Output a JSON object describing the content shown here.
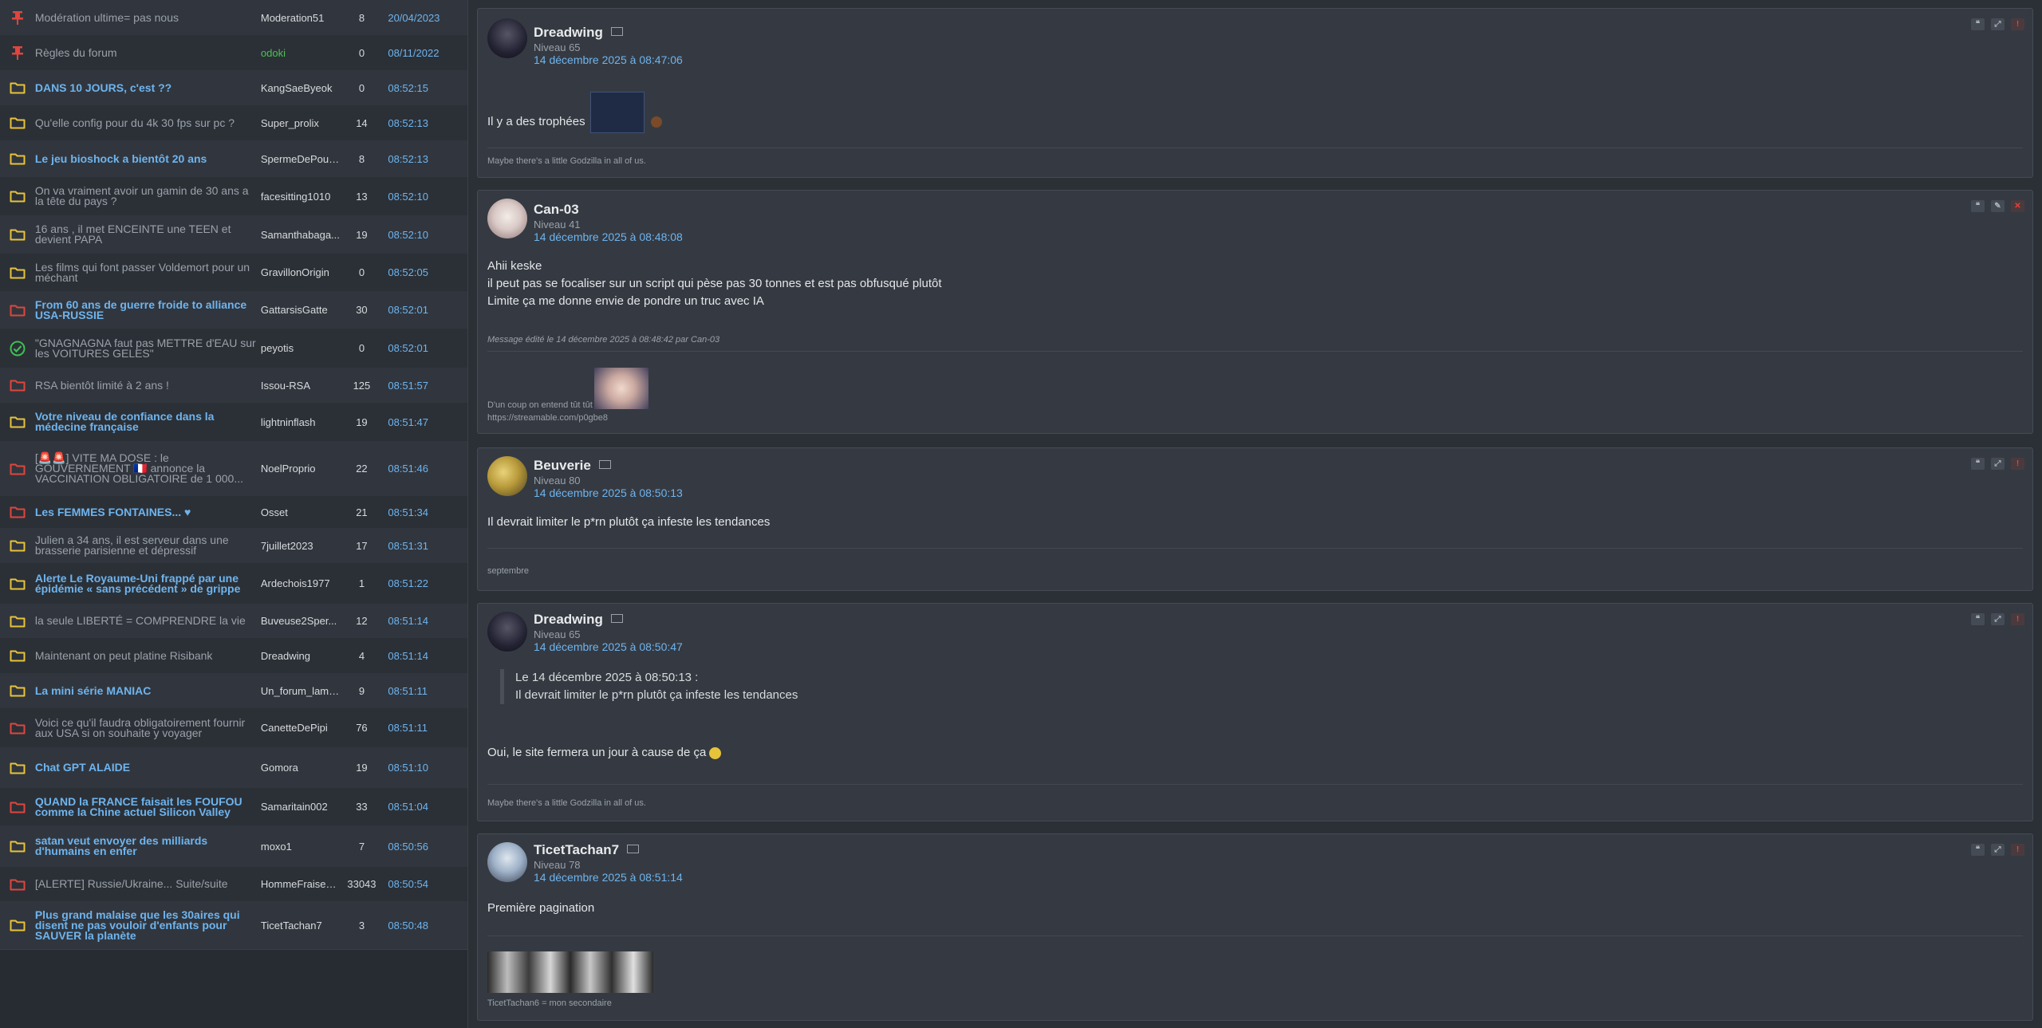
{
  "topics": [
    {
      "icon": "pin",
      "title": "Modération ultime= pas nous",
      "author": "Moderation51",
      "count": "8",
      "date": "20/04/2023",
      "style": "read"
    },
    {
      "icon": "pin",
      "title": "Règles du forum",
      "author": "odoki",
      "count": "0",
      "date": "08/11/2022",
      "style": "read",
      "admin": true
    },
    {
      "icon": "folder-yellow",
      "title": "DANS 10 JOURS, c'est ??",
      "author": "KangSaeByeok",
      "count": "0",
      "date": "08:52:15",
      "style": "hot"
    },
    {
      "icon": "folder-yellow",
      "title": "Qu'elle config pour du 4k 30 fps sur pc ?",
      "author": "Super_prolix",
      "count": "14",
      "date": "08:52:13",
      "style": "read"
    },
    {
      "icon": "folder-yellow",
      "title": "Le jeu bioshock a bientôt 20 ans",
      "author": "SpermeDePouti...",
      "count": "8",
      "date": "08:52:13",
      "style": "hot"
    },
    {
      "icon": "folder-yellow",
      "title": "On va vraiment avoir un gamin de 30 ans a la tête du pays ?",
      "author": "facesitting1010",
      "count": "13",
      "date": "08:52:10",
      "style": "read"
    },
    {
      "icon": "folder-yellow",
      "title": "16 ans , il met ENCEINTE une TEEN et devient PAPA",
      "author": "Samanthabaga...",
      "count": "19",
      "date": "08:52:10",
      "style": "read"
    },
    {
      "icon": "folder-yellow",
      "title": "Les films qui font passer Voldemort pour un méchant",
      "author": "GravillonOrigin",
      "count": "0",
      "date": "08:52:05",
      "style": "read"
    },
    {
      "icon": "folder-red",
      "title": "From 60 ans de guerre froide to alliance USA-RUSSIE",
      "author": "GattarsisGatte",
      "count": "30",
      "date": "08:52:01",
      "style": "hot"
    },
    {
      "icon": "resolved",
      "title": "\"GNAGNAGNA faut pas METTRE d'EAU sur les VOITURES GELES\"",
      "author": "peyotis",
      "count": "0",
      "date": "08:52:01",
      "style": "read"
    },
    {
      "icon": "folder-red",
      "title": "RSA bientôt limité à 2 ans !",
      "author": "Issou-RSA",
      "count": "125",
      "date": "08:51:57",
      "style": "read"
    },
    {
      "icon": "folder-yellow",
      "title": "Votre niveau de confiance dans la médecine française",
      "author": "lightninflash",
      "count": "19",
      "date": "08:51:47",
      "style": "hot"
    },
    {
      "icon": "folder-red",
      "title": "[🚨🚨] VITE MA DOSE : le GOUVERNEMENT 🇫🇷 annonce la VACCINATION OBLIGATOIRE de 1 000...",
      "author": "NoelProprio",
      "count": "22",
      "date": "08:51:46",
      "style": "read"
    },
    {
      "icon": "folder-red",
      "title": "Les FEMMES FONTAINES... ♥",
      "author": "Osset",
      "count": "21",
      "date": "08:51:34",
      "style": "hot"
    },
    {
      "icon": "folder-yellow",
      "title": "Julien a 34 ans, il est serveur dans une brasserie parisienne et dépressif",
      "author": "7juillet2023",
      "count": "17",
      "date": "08:51:31",
      "style": "read"
    },
    {
      "icon": "folder-yellow",
      "title": "Alerte Le Royaume-Uni frappé par une épidémie « sans précédent » de grippe",
      "author": "Ardechois1977",
      "count": "1",
      "date": "08:51:22",
      "style": "hot"
    },
    {
      "icon": "folder-yellow",
      "title": "la seule LIBERTÉ = COMPRENDRE la vie",
      "author": "Buveuse2Sper...",
      "count": "12",
      "date": "08:51:14",
      "style": "read"
    },
    {
      "icon": "folder-yellow",
      "title": "Maintenant on peut platine Risibank",
      "author": "Dreadwing",
      "count": "4",
      "date": "08:51:14",
      "style": "read"
    },
    {
      "icon": "folder-yellow",
      "title": "La mini série MANIAC",
      "author": "Un_forum_lamb...",
      "count": "9",
      "date": "08:51:11",
      "style": "hot"
    },
    {
      "icon": "folder-red",
      "title": "Voici ce qu'il faudra obligatoirement fournir aux USA si on souhaite y voyager",
      "author": "CanetteDePipi",
      "count": "76",
      "date": "08:51:11",
      "style": "read"
    },
    {
      "icon": "folder-yellow",
      "title": "Chat GPT ALAIDE",
      "author": "Gomora",
      "count": "19",
      "date": "08:51:10",
      "style": "hot"
    },
    {
      "icon": "folder-red",
      "title": "QUAND la FRANCE faisait les FOUFOU comme la Chine actuel Silicon Valley",
      "author": "Samaritain002",
      "count": "33",
      "date": "08:51:04",
      "style": "hot"
    },
    {
      "icon": "folder-yellow",
      "title": "satan veut envoyer des milliards d'humains en enfer",
      "author": "moxo1",
      "count": "7",
      "date": "08:50:56",
      "style": "hot"
    },
    {
      "icon": "folder-red",
      "title": "[ALERTE] Russie/Ukraine... Suite/suite",
      "author": "HommeFraiseB...",
      "count": "33043",
      "date": "08:50:54",
      "style": "read"
    },
    {
      "icon": "folder-yellow",
      "title": "Plus grand malaise que les 30aires qui disent ne pas vouloir d'enfants pour SAUVER la planète",
      "author": "TicetTachan7",
      "count": "3",
      "date": "08:50:48",
      "style": "hot"
    }
  ],
  "posts": [
    {
      "author": "Dreadwing",
      "level": "Niveau 65",
      "date": "14 décembre 2025 à 08:47:06",
      "lines": [
        "Il y a des trophées"
      ],
      "signature": "Maybe there's a little Godzilla in all of us."
    },
    {
      "author": "Can-03",
      "level": "Niveau 41",
      "date": "14 décembre 2025 à 08:48:08",
      "lines": [
        "Ahii keske",
        "il peut pas se focaliser sur un script qui pèse pas 30 tonnes et est pas obfusqué plutôt",
        "Limite ça me donne envie de pondre un truc avec IA"
      ],
      "edited": "Message édité le 14 décembre 2025 à 08:48:42 par Can-03",
      "signature": "D'un coup on entend tût tût",
      "signature2": "https://streamable.com/p0gbe8"
    },
    {
      "author": "Beuverie",
      "level": "Niveau 80",
      "date": "14 décembre 2025 à 08:50:13",
      "lines": [
        "Il devrait limiter le p*rn plutôt ça infeste les tendances"
      ],
      "signature": "septembre"
    },
    {
      "author": "Dreadwing",
      "level": "Niveau 65",
      "date": "14 décembre 2025 à 08:50:47",
      "quote_head": "Le 14 décembre 2025 à 08:50:13 :",
      "quote_body": "Il devrait limiter le p*rn plutôt ça infeste les tendances",
      "lines": [
        "Oui, le site fermera un jour à cause de ça"
      ],
      "signature": "Maybe there's a little Godzilla in all of us."
    },
    {
      "author": "TicetTachan7",
      "level": "Niveau 78",
      "date": "14 décembre 2025 à 08:51:14",
      "lines": [
        "Première pagination"
      ],
      "signature": "TicetTachan6 = mon secondaire"
    }
  ],
  "colors": {
    "link": "#6eb4ee",
    "folder_yellow": "#e7c33a",
    "folder_red": "#e0453d",
    "resolved": "#3fbf52",
    "admin": "#4cc350"
  }
}
